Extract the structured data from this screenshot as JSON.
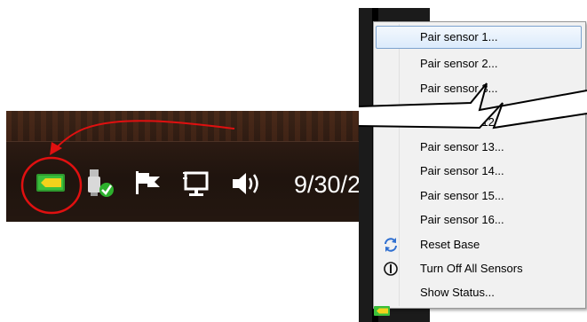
{
  "taskbar": {
    "clock_text": "9/30/2",
    "tray_icons": [
      "sensor-app-icon",
      "safely-remove-usb-icon",
      "action-center-flag-icon",
      "network-icon",
      "volume-icon"
    ]
  },
  "annotation": {
    "color": "#e01010",
    "note": ""
  },
  "context_menu": {
    "items": [
      {
        "label": "Pair sensor 1...",
        "highlighted": true
      },
      {
        "label": "Pair sensor 2..."
      },
      {
        "label": "Pair sensor 3..."
      },
      {
        "label": "Pair sensor 12..."
      },
      {
        "label": "Pair sensor 13..."
      },
      {
        "label": "Pair sensor 14..."
      },
      {
        "label": "Pair sensor 15..."
      },
      {
        "label": "Pair sensor 16..."
      },
      {
        "label": "Reset Base",
        "icon": "reset-arrows-icon"
      },
      {
        "label": "Turn Off All Sensors",
        "icon": "power-icon"
      },
      {
        "label": "Show Status..."
      }
    ]
  },
  "colors": {
    "menu_bg": "#f1f1f1",
    "highlight_border": "#7da2ce",
    "app_icon_green": "#3bbf3b",
    "app_icon_yellow": "#f2d21c"
  }
}
